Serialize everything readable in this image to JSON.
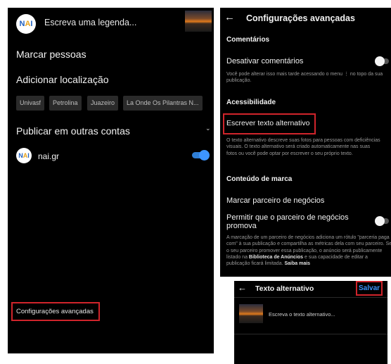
{
  "left": {
    "avatar_text": "NAI",
    "caption_placeholder": "Escreva uma legenda...",
    "tag_people": "Marcar pessoas",
    "add_location": "Adicionar localização",
    "location_chips": [
      "Univasf",
      "Petrolina",
      "Juazeiro",
      "La Onde Os Pilantras N..."
    ],
    "share_other_accounts": "Publicar em outras contas",
    "account_name": "nai.gr",
    "account_toggle_on": true,
    "advanced_settings": "Configurações avançadas"
  },
  "right": {
    "title": "Configurações avançadas",
    "comments_header": "Comentários",
    "disable_comments": "Desativar comentários",
    "comments_note": "Você pode alterar isso mais tarde acessando o menu ⋮ no topo da sua publicação.",
    "accessibility_header": "Acessibilidade",
    "alt_text": "Escrever texto alternativo",
    "alt_text_note": "O texto alternativo descreve suas fotos para pessoas com deficiências visuais. O texto alternativo será criado automaticamente nas suas fotos ou você pode optar por escrever o seu próprio texto.",
    "brand_header": "Conteúdo de marca",
    "tag_partner": "Marcar parceiro de negócios",
    "allow_partner_line1": "Permitir que o parceiro de negócios",
    "allow_partner_line2": "promova",
    "partner_note_1": "A marcação de um parceiro de negócios adiciona um rótulo \"parceria paga com\" à sua publicação e compartilha as métricas dela com seu parceiro. Se o seu parceiro promover essa publicação, o anúncio será publicamente listado na",
    "partner_note_link": "Biblioteca de Anúncios",
    "partner_note_2": "e sua capacidade de editar a publicação ficará limitada.",
    "partner_note_more": "Saiba mais"
  },
  "bottom": {
    "title": "Texto alternativo",
    "save": "Salvar",
    "alt_placeholder": "Escreva o texto alternativo..."
  },
  "colors": {
    "background": "#000000",
    "highlight": "#d0242b",
    "toggle_on": "#3d95ff",
    "save_link": "#3d95ff"
  }
}
